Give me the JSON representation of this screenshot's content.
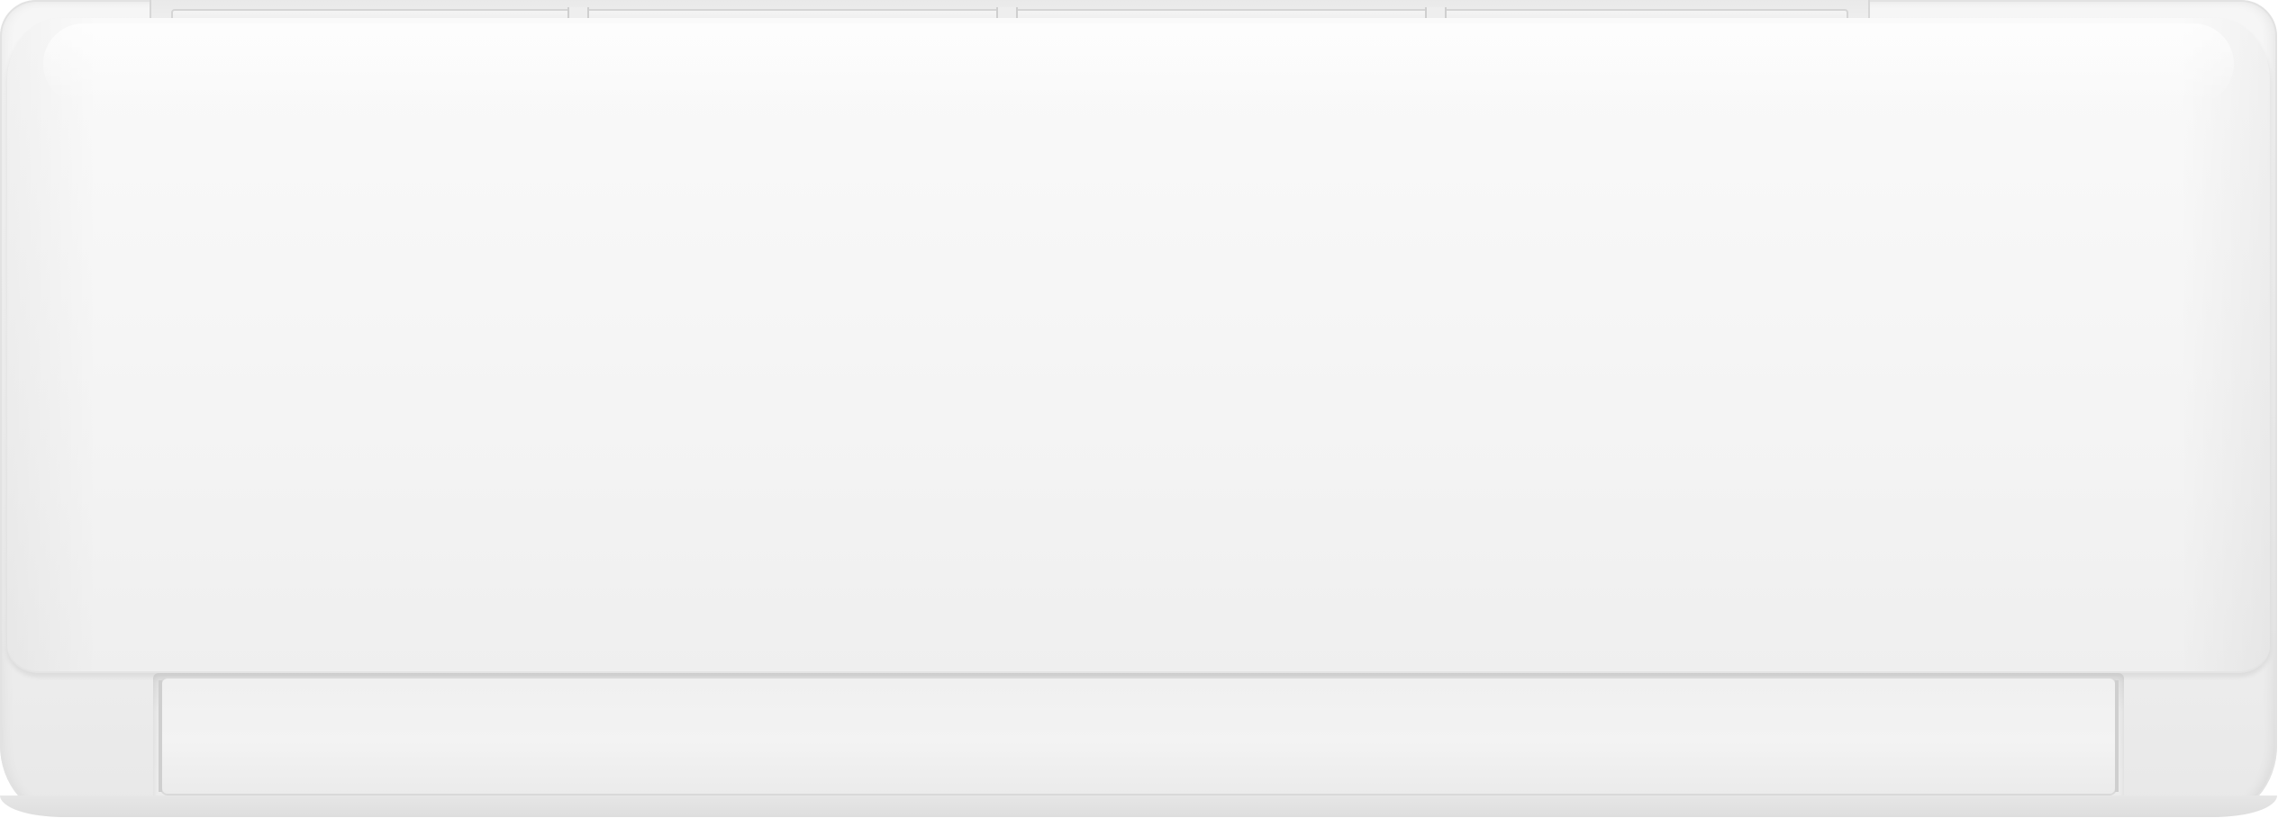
{
  "scene": {
    "subject": "wall-mounted-air-conditioner-indoor-unit",
    "colors": {
      "body": "#f3f3f3",
      "panel": "#f7f7f7",
      "grille": "#e9e9e9",
      "louver": "#f0f0f0",
      "outline": "#d7d7d7"
    }
  }
}
